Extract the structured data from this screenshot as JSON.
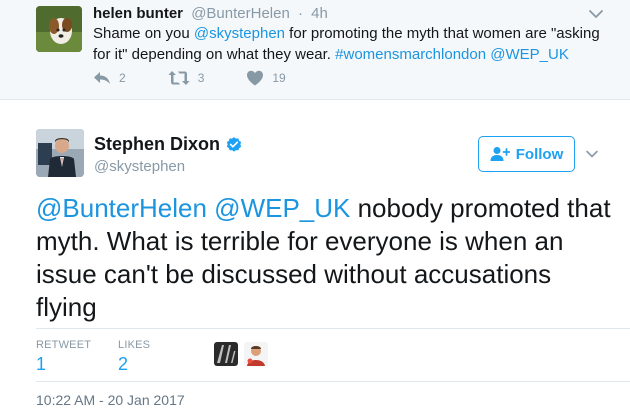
{
  "parent_tweet": {
    "author_name": "helen bunter",
    "author_handle": "@BunterHelen",
    "separator": "·",
    "time_ago": "4h",
    "text_1": "Shame on you ",
    "mention_1": "@skystephen",
    "text_2": " for promoting the myth that women are \"asking for it\" depending on what they wear. ",
    "hashtag": "#womensmarchlondon",
    "text_3": " ",
    "mention_2": "@WEP_UK",
    "reply_count": "2",
    "retweet_count": "3",
    "like_count": "19"
  },
  "main_tweet": {
    "author_name": "Stephen Dixon",
    "author_handle": "@skystephen",
    "follow_label": "Follow",
    "mention_1": "@BunterHelen",
    "mention_2": "@WEP_UK",
    "text": " nobody promoted that myth. What is terrible for everyone is when an issue can't be discussed without accusations flying",
    "retweet_label": "RETWEET",
    "retweet_value": "1",
    "likes_label": "LIKES",
    "likes_value": "2",
    "timestamp": "10:22 AM - 20 Jan 2017"
  },
  "colors": {
    "accent": "#1da1f2",
    "link": "#1b95e0",
    "muted": "#8899a6",
    "parent_bg": "#f5f8fa"
  },
  "icons": {
    "reply": "reply-icon",
    "retweet": "retweet-icon",
    "like": "heart-icon",
    "verified": "verified-badge-icon",
    "follow": "add-user-icon",
    "menu": "chevron-down-icon"
  }
}
